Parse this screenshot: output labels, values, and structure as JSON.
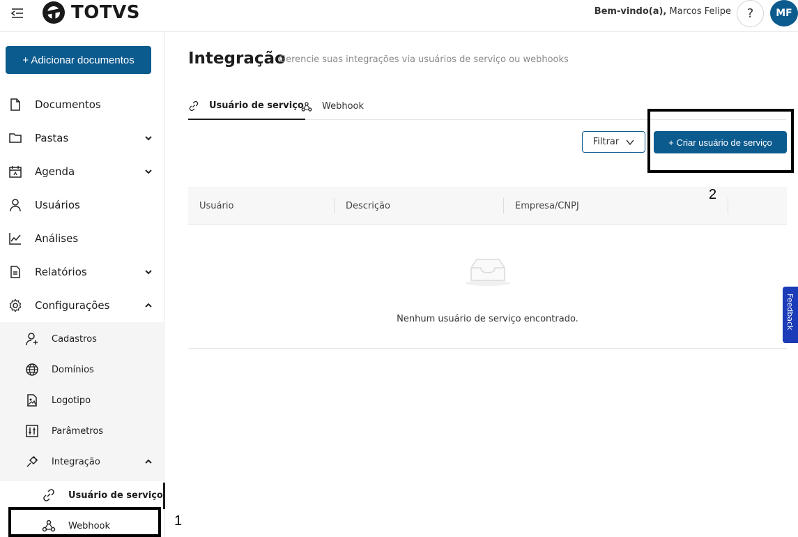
{
  "header": {
    "brand": "TOTVS",
    "welcome_prefix": "Bem-vindo(a),",
    "welcome_name": " Marcos Felipe",
    "help_label": "?",
    "avatar_initials": "MF"
  },
  "sidebar": {
    "add_button": "+ Adicionar documentos",
    "items": [
      {
        "label": "Documentos",
        "icon": "document-icon"
      },
      {
        "label": "Pastas",
        "icon": "folder-icon",
        "chevron": "down"
      },
      {
        "label": "Agenda",
        "icon": "calendar-icon",
        "chevron": "down"
      },
      {
        "label": "Usuários",
        "icon": "user-icon"
      },
      {
        "label": "Análises",
        "icon": "chart-line-icon"
      },
      {
        "label": "Relatórios",
        "icon": "report-icon",
        "chevron": "down"
      },
      {
        "label": "Configurações",
        "icon": "gear-icon",
        "chevron": "up"
      }
    ],
    "config_sub": [
      {
        "label": "Cadastros",
        "icon": "user-add-icon"
      },
      {
        "label": "Domínios",
        "icon": "globe-icon"
      },
      {
        "label": "Logotipo",
        "icon": "image-file-icon"
      },
      {
        "label": "Parâmetros",
        "icon": "sliders-icon"
      },
      {
        "label": "Integração",
        "icon": "plug-icon",
        "chevron": "up"
      }
    ],
    "integration_sub": [
      {
        "label": "Usuário de serviço",
        "icon": "link-icon",
        "active": true
      },
      {
        "label": "Webhook",
        "icon": "webhook-icon"
      }
    ]
  },
  "main": {
    "title": "Integração",
    "subtitle": "Gerencie suas integrações via usuários de serviço ou webhooks",
    "tabs": [
      {
        "label": "Usuário de serviço",
        "active": true
      },
      {
        "label": "Webhook"
      }
    ],
    "filter_label": "Filtrar",
    "create_label": "+ Criar usuário de serviço",
    "table": {
      "columns": [
        "Usuário",
        "Descrição",
        "Empresa/CNPJ"
      ],
      "empty_text": "Nenhum usuário de serviço encontrado."
    },
    "feedback_label": "Feedback"
  },
  "annotations": {
    "one": "1",
    "two": "2"
  },
  "colors": {
    "primary": "#0c5b8f",
    "feedback": "#1b3bb8"
  }
}
